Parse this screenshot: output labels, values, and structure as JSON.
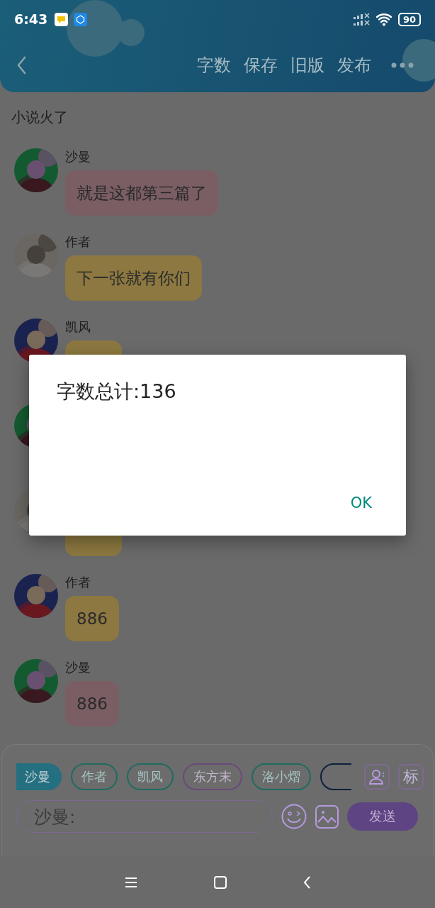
{
  "status_bar": {
    "time": "6:43",
    "battery": "90"
  },
  "header": {
    "actions": [
      "字数",
      "保存",
      "旧版",
      "发布"
    ]
  },
  "chat_title": "小说火了",
  "messages": [
    {
      "kind": "message",
      "name": "沙曼",
      "text": "就是这都第三篇了",
      "color": "#7a5e63"
    },
    {
      "kind": "message",
      "name": "作者",
      "text": "下一张就有你们",
      "color": "#8c7840"
    },
    {
      "kind": "message",
      "name": "凯风",
      "color": "#8c7840"
    },
    {
      "kind": "avatar_only"
    },
    {
      "kind": "message",
      "color": "#8c7840"
    },
    {
      "kind": "message",
      "name": "作者",
      "text": "886",
      "color": "#8c7840"
    },
    {
      "kind": "message",
      "name": "沙曼",
      "text": "886",
      "color": "#7a5e63"
    }
  ],
  "dialog": {
    "message": "字数总计:136",
    "button": "OK"
  },
  "composer": {
    "chips": [
      {
        "label": "沙曼",
        "selected": true,
        "color": "#246f80"
      },
      {
        "label": "作者",
        "selected": false,
        "color": "#1f6b62"
      },
      {
        "label": "凯风",
        "selected": false,
        "color": "#1f6b62"
      },
      {
        "label": "东方末",
        "selected": false,
        "color": "#6a4a7a"
      },
      {
        "label": "洛小熠",
        "selected": false,
        "color": "#1f6b62"
      },
      {
        "selected": false,
        "color": "#0c1f3e"
      }
    ],
    "mark_button": "标",
    "input_value": "沙曼:",
    "send_button": "发送"
  }
}
